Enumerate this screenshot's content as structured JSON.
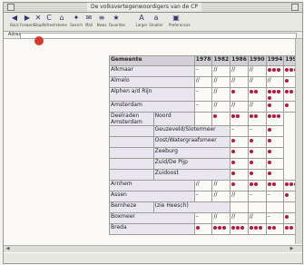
{
  "window": {
    "title": "De volksvertegenwoordigers van de CP"
  },
  "toolbar": {
    "buttons": [
      {
        "label": "Back",
        "icon": "◀"
      },
      {
        "label": "Forward",
        "icon": "▶"
      },
      {
        "label": "Stop",
        "icon": "✕"
      },
      {
        "label": "Refresh",
        "icon": "C"
      },
      {
        "label": "Home",
        "icon": "⌂"
      },
      {
        "label": "Search",
        "icon": "✦"
      },
      {
        "label": "Mail",
        "icon": "✉"
      },
      {
        "label": "News",
        "icon": "≡"
      },
      {
        "label": "Favorites",
        "icon": "★"
      },
      {
        "label": "Larger",
        "icon": "A"
      },
      {
        "label": "Smaller",
        "icon": "a"
      },
      {
        "label": "Preferences",
        "icon": "▣"
      }
    ]
  },
  "address": {
    "label": "Adres:",
    "value": ""
  },
  "table": {
    "headers": [
      "Gemeente",
      "1978",
      "1982",
      "1986",
      "1990",
      "1994",
      "1998"
    ],
    "rows": [
      {
        "gemeente": "Alkmaar",
        "values": [
          "–",
          "//",
          "//",
          "//",
          "●●●",
          "●●●"
        ]
      },
      {
        "gemeente": "Almelo",
        "values": [
          "//",
          "//",
          "//",
          "//",
          "//",
          "●"
        ]
      },
      {
        "gemeente": "Alphen a/d Rijn",
        "values": [
          "–",
          "//",
          "●",
          "●●",
          "●●●●",
          "●●"
        ]
      },
      {
        "gemeente": "Amsterdam",
        "values": [
          "–",
          "//",
          "//",
          "//",
          "●",
          "●"
        ]
      },
      {
        "gemeente": "Deelraden Amsterdam",
        "sub": "Noord",
        "values": [
          "",
          "",
          "●",
          "●●",
          "●●",
          "●●●"
        ]
      },
      {
        "gemeente": "",
        "sub": "Geuzeveld/Slotermeer",
        "values": [
          "",
          "",
          "",
          "–",
          "–",
          "●"
        ]
      },
      {
        "gemeente": "",
        "sub": "Oost/Watergraafsmeer",
        "values": [
          "",
          "",
          "",
          "●",
          "●",
          "●"
        ]
      },
      {
        "gemeente": "",
        "sub": "Zeeburg",
        "values": [
          "",
          "",
          "",
          "●",
          "●",
          "●"
        ]
      },
      {
        "gemeente": "",
        "sub": "Zuid/De Pijp",
        "values": [
          "",
          "",
          "",
          "●",
          "●",
          "●"
        ]
      },
      {
        "gemeente": "",
        "sub": "Zuidoost",
        "values": [
          "",
          "",
          "",
          "●",
          "●",
          "●"
        ]
      },
      {
        "gemeente": "Arnhem",
        "values": [
          "//",
          "//",
          "●",
          "●●",
          "●●",
          "●●●"
        ]
      },
      {
        "gemeente": "Assen",
        "values": [
          "–",
          "//",
          "//",
          "–",
          "–",
          "●"
        ]
      },
      {
        "gemeente": "Bernheze",
        "sub": "(zie Heesch)",
        "values": [
          "",
          "",
          "",
          "",
          "",
          ""
        ]
      },
      {
        "gemeente": "Boxmeer",
        "values": [
          "–",
          "//",
          "//",
          "//",
          "–",
          "●"
        ]
      },
      {
        "gemeente": "Breda",
        "values": [
          "●",
          "●●●",
          "●●●",
          "●●●",
          "●●",
          "●●"
        ]
      }
    ]
  }
}
